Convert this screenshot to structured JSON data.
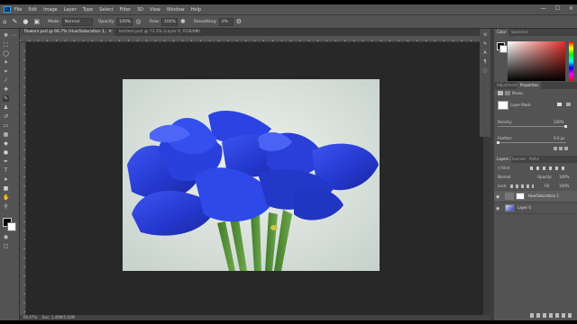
{
  "app": {
    "logo": "Ps",
    "menu": [
      "File",
      "Edit",
      "Image",
      "Layer",
      "Type",
      "Select",
      "Filter",
      "3D",
      "View",
      "Window",
      "Help"
    ],
    "window_controls": [
      "—",
      "☐",
      "✕"
    ]
  },
  "options_bar": {
    "mode_label": "Mode:",
    "mode_value": "Normal",
    "opacity_label": "Opacity:",
    "opacity_value": "100%",
    "flow_label": "Flow:",
    "flow_value": "100%",
    "smoothing_label": "Smoothing:",
    "smoothing_value": "0%"
  },
  "tabs": [
    {
      "label": "flowers.psd @ 66.7% (Hue/Saturation 1, Layer Mask/8) *",
      "active": true
    },
    {
      "label": "lemlem.psd @ 73.3% (Layer 0, RGB/8#) *",
      "active": false
    }
  ],
  "status": {
    "zoom": "66.67%",
    "doc": "Doc: 1.40M/5.60M"
  },
  "panels": {
    "color_tabs": [
      "Color",
      "Swatches"
    ],
    "adjust_tabs": [
      "Adjustments",
      "Properties"
    ],
    "properties": {
      "type": "Masks",
      "mask_label": "Layer Mask",
      "density_label": "Density:",
      "density_value": "100%",
      "feather_label": "Feather:",
      "feather_value": "0.0 px"
    },
    "layers_tabs": [
      "Layers",
      "Channels",
      "Paths"
    ],
    "kind_label": "Kind",
    "blend_mode": "Normal",
    "opacity_label": "Opacity:",
    "opacity_value": "100%",
    "lock_label": "Lock:",
    "fill_label": "Fill:",
    "fill_value": "100%",
    "layers": [
      {
        "name": "Hue/Saturation 1",
        "active": true
      },
      {
        "name": "Layer 0",
        "active": false
      }
    ]
  },
  "colors": {
    "background": "#424242",
    "panel": "#535353",
    "canvas": "#282828",
    "flower": "#2a3fd8",
    "photo_bg": "#d9e2dc"
  },
  "icons": {
    "tools": [
      "move-icon",
      "marquee-icon",
      "lasso-icon",
      "magic-wand-icon",
      "crop-icon",
      "eyedropper-icon",
      "healing-icon",
      "brush-icon",
      "stamp-icon",
      "history-brush-icon",
      "eraser-icon",
      "gradient-icon",
      "blur-icon",
      "dodge-icon",
      "pen-icon",
      "type-icon",
      "path-select-icon",
      "shape-icon",
      "hand-icon",
      "zoom-icon"
    ]
  }
}
